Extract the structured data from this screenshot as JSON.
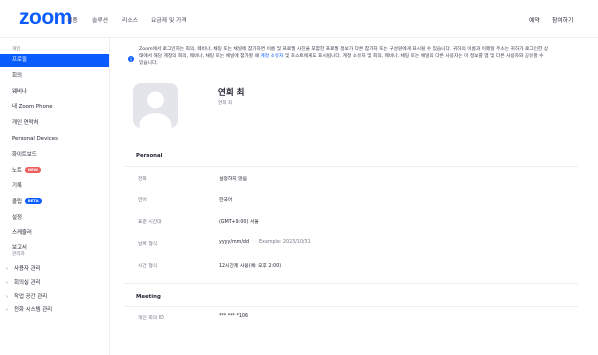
{
  "header": {
    "logo": "zoom",
    "nav": [
      "제품",
      "솔루션",
      "리소스",
      "요금제 및 가격"
    ],
    "right": [
      "예약",
      "참여하기"
    ]
  },
  "sidebar": {
    "personal_label": "개인",
    "items": [
      {
        "label": "프로필",
        "active": true
      },
      {
        "label": "회의"
      },
      {
        "label": "웨비나"
      },
      {
        "label": "내 Zoom Phone"
      },
      {
        "label": "개인 연락처"
      },
      {
        "label": "Personal Devices"
      },
      {
        "label": "화이트보드"
      },
      {
        "label": "노트",
        "badge": "NEW"
      },
      {
        "label": "기록"
      },
      {
        "label": "클립",
        "badge": "BETA"
      },
      {
        "label": "설정"
      },
      {
        "label": "스케줄러"
      },
      {
        "label": "보고서"
      }
    ],
    "admin_label": "관리자",
    "admin_items": [
      "사용자 관리",
      "회의실 관리",
      "작업 공간 관리",
      "전화 시스템 관리"
    ]
  },
  "notice": {
    "text_before": "Zoom에서 로그인하는 회의, 웨비나, 채팅 또는 채널에 참가하면 이름 및 프로필 사진을 포함한 프로필 정보가 다른 참가자 또는 구성원에게 표시될 수 있습니다. 귀하의 이름과 이메일 주소는 귀하가 로그인한 상태에서 해당 계정의 회의, 웨비나, 채팅 또는 채널에 참가할 때",
    "link": "계정 소유자",
    "text_after": "및 호스트에게도 표시됩니다. 계정 소유자 및 회의, 웨비나, 채팅 또는 채널의 다른 사용자는 이 정보를 앱 및 다른 사용자와 공유할 수 있습니다."
  },
  "profile": {
    "name": "연희 최",
    "subname": "연희 최"
  },
  "personal": {
    "title": "Personal",
    "rows": [
      {
        "label": "전화",
        "value": "설정하지 않음"
      },
      {
        "label": "언어",
        "value": "한국어"
      },
      {
        "label": "표준 시간대",
        "value": "(GMT+9:00) 서울"
      },
      {
        "label": "날짜 형식",
        "value": "yyyy/mm/dd",
        "extra": "Example: 2023/10/31"
      },
      {
        "label": "시간 형식",
        "value": "12시간제 사용(예: 오후 2:00)"
      }
    ]
  },
  "meeting": {
    "title": "Meeting",
    "rows": [
      {
        "label": "개인 회의 ID",
        "value": "*** *** *106"
      }
    ]
  },
  "colors": {
    "accent": "#0b5cff",
    "new_badge": "#ec5d5d"
  }
}
